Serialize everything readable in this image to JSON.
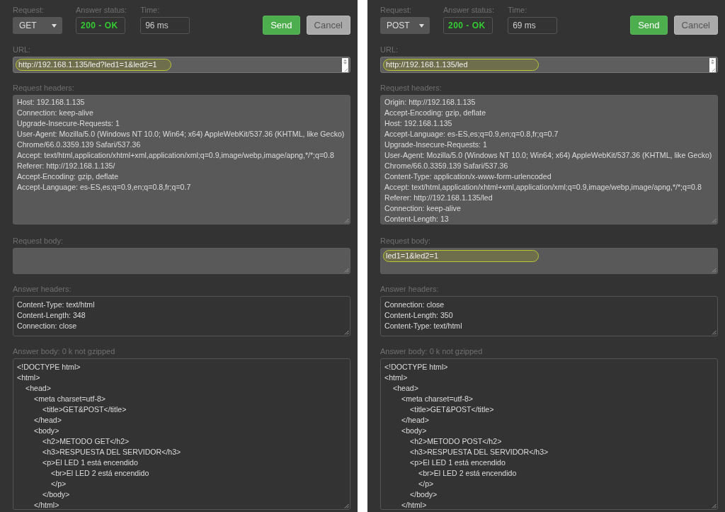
{
  "panels": [
    {
      "request_label": "Request:",
      "method": "GET",
      "status_label": "Answer status:",
      "answer_status": "200 - OK",
      "status_ok": true,
      "time_label": "Time:",
      "time": "96 ms",
      "buttons": [
        {
          "kind": "send",
          "label": "Send"
        },
        {
          "kind": "cancel",
          "label": "Cancel"
        }
      ],
      "url": {
        "label": "URL:",
        "value": "http://192.168.1.135/led?led1=1&led2=1",
        "highlighted": true
      },
      "request_headers": {
        "label": "Request headers:",
        "lines": [
          "Host: 192.168.1.135",
          "Connection: keep-alive",
          "Upgrade-Insecure-Requests: 1",
          "User-Agent: Mozilla/5.0 (Windows NT 10.0; Win64; x64) AppleWebKit/537.36 (KHTML, like Gecko)",
          "Chrome/66.0.3359.139 Safari/537.36",
          "Accept: text/html,application/xhtml+xml,application/xml;q=0.9,image/webp,image/apng,*/*;q=0.8",
          "Referer: http://192.168.1.135/",
          "Accept-Encoding: gzip, deflate",
          "Accept-Language: es-ES,es;q=0.9,en;q=0.8,fr;q=0.7"
        ]
      },
      "request_body": {
        "label": "Request body:",
        "highlighted": false
      },
      "answer_headers": {
        "label": "Answer headers:",
        "lines": [
          "Content-Type: text/html",
          "Content-Length: 348",
          "Connection: close"
        ]
      },
      "answer_body": {
        "label": "Answer body: 0 k not gzipped",
        "lines": [
          {
            "text": "<!DOCTYPE html>"
          },
          {
            "text": "<html>",
            "children": [
              {
                "text": "<head>",
                "children": [
                  {
                    "text": "<meta charset=utf-8>",
                    "children": [
                      {
                        "text": "<title>GET&POST</title>"
                      }
                    ]
                  },
                  {
                    "text": "</head>"
                  },
                  {
                    "text": "<body>",
                    "children": [
                      {
                        "text": "<h2>METODO GET</h2>"
                      },
                      {
                        "text": "<h3>RESPUESTA DEL SERVIDOR</h3>"
                      },
                      {
                        "text": "<p>El LED 1 está encendido",
                        "children": [
                          {
                            "text": "<br>El LED 2 está encendido"
                          },
                          {
                            "text": "</p>"
                          }
                        ]
                      },
                      {
                        "text": "</body>"
                      }
                    ]
                  },
                  {
                    "text": "</html>"
                  }
                ]
              }
            ]
          }
        ]
      }
    },
    {
      "request_label": "Request:",
      "method": "POST",
      "status_label": "Answer status:",
      "answer_status": "200 - OK",
      "status_ok": true,
      "time_label": "Time:",
      "time": "69 ms",
      "buttons": [
        {
          "kind": "send",
          "label": "Send"
        },
        {
          "kind": "cancel",
          "label": "Cancel"
        }
      ],
      "url": {
        "label": "URL:",
        "value": "http://192.168.1.135/led",
        "highlighted": true
      },
      "request_headers": {
        "label": "Request headers:",
        "lines": [
          "Origin: http://192.168.1.135",
          "Accept-Encoding: gzip, deflate",
          "Host: 192.168.1.135",
          "Accept-Language: es-ES,es;q=0.9,en;q=0.8,fr;q=0.7",
          "Upgrade-Insecure-Requests: 1",
          "User-Agent: Mozilla/5.0 (Windows NT 10.0; Win64; x64) AppleWebKit/537.36 (KHTML, like Gecko)",
          "Chrome/66.0.3359.139 Safari/537.36",
          "Content-Type: application/x-www-form-urlencoded",
          "Accept: text/html,application/xhtml+xml,application/xml;q=0.9,image/webp,image/apng,*/*;q=0.8",
          "Referer: http://192.168.1.135/led",
          "Connection: keep-alive",
          "Content-Length: 13"
        ]
      },
      "request_body": {
        "label": "Request body:",
        "value": "led1=1&led2=1",
        "highlighted": true
      },
      "answer_headers": {
        "label": "Answer headers:",
        "lines": [
          "Connection: close",
          "Content-Length: 350",
          "Content-Type: text/html"
        ]
      },
      "answer_body": {
        "label": "Answer body: 0 k not gzipped",
        "lines": [
          {
            "text": "<!DOCTYPE html>"
          },
          {
            "text": "<html>",
            "children": [
              {
                "text": "<head>",
                "children": [
                  {
                    "text": "<meta charset=utf-8>",
                    "children": [
                      {
                        "text": "<title>GET&POST</title>"
                      }
                    ]
                  },
                  {
                    "text": "</head>"
                  },
                  {
                    "text": "<body>",
                    "children": [
                      {
                        "text": "<h2>METODO POST</h2>"
                      },
                      {
                        "text": "<h3>RESPUESTA DEL SERVIDOR</h3>"
                      },
                      {
                        "text": "<p>El LED 1 está encendido",
                        "children": [
                          {
                            "text": "<br>El LED 2 está encendido"
                          },
                          {
                            "text": "</p>"
                          }
                        ]
                      },
                      {
                        "text": "</body>"
                      }
                    ]
                  },
                  {
                    "text": "</html>"
                  }
                ]
              }
            ]
          }
        ]
      }
    }
  ]
}
